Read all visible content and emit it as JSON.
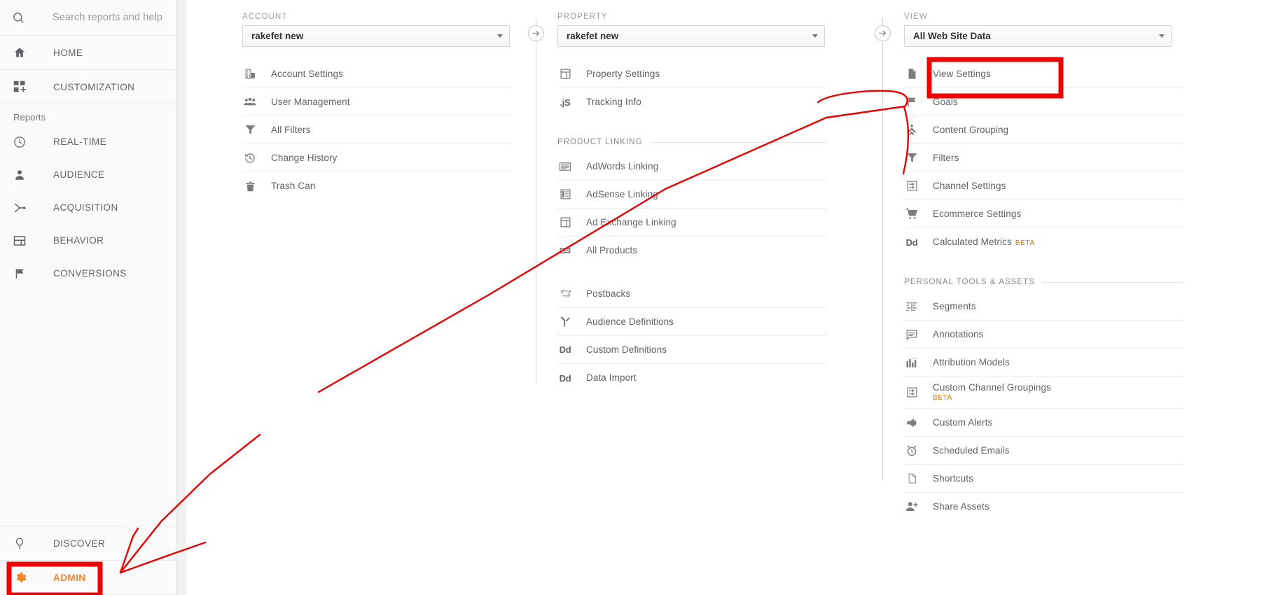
{
  "sidebar": {
    "search": {
      "placeholder": "Search reports and help",
      "icon": "search-icon"
    },
    "top_items": [
      {
        "label": "HOME",
        "icon": "home-icon"
      },
      {
        "label": "CUSTOMIZATION",
        "icon": "customization-icon"
      }
    ],
    "reports_section_label": "Reports",
    "report_items": [
      {
        "label": "REAL-TIME",
        "icon": "clock-icon"
      },
      {
        "label": "AUDIENCE",
        "icon": "person-icon"
      },
      {
        "label": "ACQUISITION",
        "icon": "acquisition-icon"
      },
      {
        "label": "BEHAVIOR",
        "icon": "behavior-icon"
      },
      {
        "label": "CONVERSIONS",
        "icon": "flag-icon"
      }
    ],
    "bottom_items": [
      {
        "label": "DISCOVER",
        "icon": "lightbulb-icon",
        "active": false
      },
      {
        "label": "ADMIN",
        "icon": "gear-icon",
        "active": true
      }
    ]
  },
  "account": {
    "header": "ACCOUNT",
    "selected": "rakefet new",
    "items": [
      {
        "label": "Account Settings",
        "icon": "building-icon"
      },
      {
        "label": "User Management",
        "icon": "people-icon"
      },
      {
        "label": "All Filters",
        "icon": "funnel-icon"
      },
      {
        "label": "Change History",
        "icon": "history-icon"
      },
      {
        "label": "Trash Can",
        "icon": "trash-icon"
      }
    ]
  },
  "property": {
    "header": "PROPERTY",
    "selected": "rakefet new",
    "items": [
      {
        "label": "Property Settings",
        "icon": "page-layout-icon"
      },
      {
        "label": "Tracking Info",
        "icon": "js-icon"
      }
    ],
    "product_linking_label": "PRODUCT LINKING",
    "product_linking_items": [
      {
        "label": "AdWords Linking",
        "icon": "adwords-icon"
      },
      {
        "label": "AdSense Linking",
        "icon": "adsense-icon"
      },
      {
        "label": "Ad Exchange Linking",
        "icon": "adexchange-icon"
      },
      {
        "label": "All Products",
        "icon": "link-icon"
      }
    ],
    "extra_items": [
      {
        "label": "Postbacks",
        "icon": "postbacks-icon"
      },
      {
        "label": "Audience Definitions",
        "icon": "audience-def-icon"
      },
      {
        "label": "Custom Definitions",
        "icon": "dd-icon"
      },
      {
        "label": "Data Import",
        "icon": "dd-icon"
      }
    ]
  },
  "view": {
    "header": "VIEW",
    "selected": "All Web Site Data",
    "items": [
      {
        "label": "View Settings",
        "icon": "document-icon",
        "highlighted": true
      },
      {
        "label": "Goals",
        "icon": "flag-icon"
      },
      {
        "label": "Content Grouping",
        "icon": "content-grouping-icon"
      },
      {
        "label": "Filters",
        "icon": "funnel-icon"
      },
      {
        "label": "Channel Settings",
        "icon": "channel-icon"
      },
      {
        "label": "Ecommerce Settings",
        "icon": "cart-icon"
      },
      {
        "label": "Calculated Metrics",
        "icon": "dd-icon",
        "badge": "BETA"
      }
    ],
    "personal_tools_label": "PERSONAL TOOLS & ASSETS",
    "personal_tools_items": [
      {
        "label": "Segments",
        "icon": "segments-icon"
      },
      {
        "label": "Annotations",
        "icon": "annotation-icon"
      },
      {
        "label": "Attribution Models",
        "icon": "bar-chart-icon"
      },
      {
        "label": "Custom Channel Groupings",
        "icon": "channel-icon",
        "badge": "BETA",
        "badge_block": true
      },
      {
        "label": "Custom Alerts",
        "icon": "megaphone-icon"
      },
      {
        "label": "Scheduled Emails",
        "icon": "alarm-clock-icon"
      },
      {
        "label": "Shortcuts",
        "icon": "shortcut-page-icon"
      },
      {
        "label": "Share Assets",
        "icon": "person-add-icon"
      }
    ]
  },
  "annotations": {
    "accent_color": "#f20000",
    "admin_highlight": "ADMIN",
    "view_settings_highlight": "View Settings"
  }
}
